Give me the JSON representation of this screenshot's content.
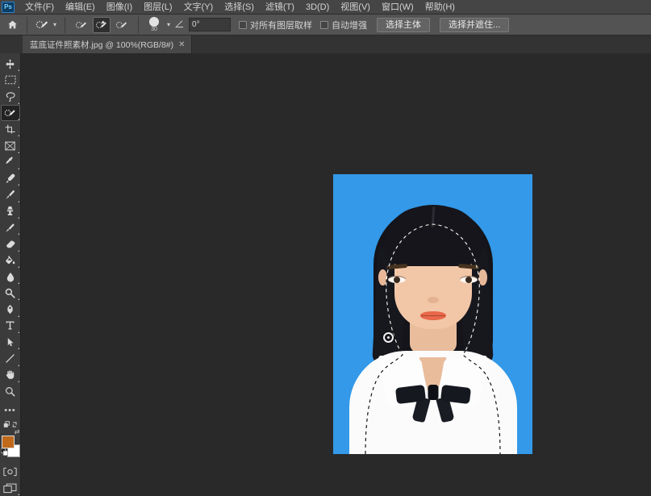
{
  "app": {
    "name": "Adobe Photoshop",
    "logo_text": "Ps",
    "logo_color": "#2d7fd0"
  },
  "menubar": {
    "items": [
      {
        "label": "文件(F)",
        "name": "menu-file"
      },
      {
        "label": "编辑(E)",
        "name": "menu-edit"
      },
      {
        "label": "图像(I)",
        "name": "menu-image"
      },
      {
        "label": "图层(L)",
        "name": "menu-layer"
      },
      {
        "label": "文字(Y)",
        "name": "menu-type"
      },
      {
        "label": "选择(S)",
        "name": "menu-select"
      },
      {
        "label": "滤镜(T)",
        "name": "menu-filter"
      },
      {
        "label": "3D(D)",
        "name": "menu-3d"
      },
      {
        "label": "视图(V)",
        "name": "menu-view"
      },
      {
        "label": "窗口(W)",
        "name": "menu-window"
      },
      {
        "label": "帮助(H)",
        "name": "menu-help"
      }
    ]
  },
  "options_bar": {
    "home_icon": "home-icon",
    "tool_preset_icon": "quick-selection-brush-icon",
    "modes": [
      {
        "name": "new-selection-mode",
        "icon": "brush-new-icon",
        "active": false
      },
      {
        "name": "add-to-selection-mode",
        "icon": "brush-add-icon",
        "active": true
      },
      {
        "name": "subtract-from-selection-mode",
        "icon": "brush-subtract-icon",
        "active": false
      }
    ],
    "brush_size": "30",
    "angle_value": "0°",
    "sample_all_layers": {
      "label": "对所有图层取样",
      "checked": false
    },
    "auto_enhance": {
      "label": "自动增强",
      "checked": false
    },
    "select_subject_label": "选择主体",
    "select_and_mask_label": "选择并遮住..."
  },
  "tabs": [
    {
      "title": "蓝底证件照素材.jpg @ 100%(RGB/8#)",
      "close_icon": "close-icon",
      "active": true
    }
  ],
  "toolbar": {
    "tools": [
      {
        "name": "move-tool",
        "icon": "move-icon",
        "glyph": "✥",
        "active": false
      },
      {
        "name": "rectangular-marquee-tool",
        "icon": "marquee-icon",
        "glyph": "▭",
        "active": false
      },
      {
        "name": "lasso-tool",
        "icon": "lasso-icon",
        "glyph": "lasso",
        "active": false
      },
      {
        "name": "quick-selection-tool",
        "icon": "quick-selection-icon",
        "glyph": "brush",
        "active": true
      },
      {
        "name": "crop-tool",
        "icon": "crop-icon",
        "glyph": "crop",
        "active": false
      },
      {
        "name": "frame-tool",
        "icon": "frame-icon",
        "glyph": "⊠",
        "active": false
      },
      {
        "name": "eyedropper-tool",
        "icon": "eyedropper-icon",
        "glyph": "dropper",
        "active": false
      },
      {
        "name": "spot-healing-brush-tool",
        "icon": "healing-brush-icon",
        "glyph": "heal",
        "active": false
      },
      {
        "name": "brush-tool",
        "icon": "brush-icon",
        "glyph": "brush2",
        "active": false
      },
      {
        "name": "clone-stamp-tool",
        "icon": "clone-stamp-icon",
        "glyph": "stamp",
        "active": false
      },
      {
        "name": "history-brush-tool",
        "icon": "history-brush-icon",
        "glyph": "hbrush",
        "active": false
      },
      {
        "name": "eraser-tool",
        "icon": "eraser-icon",
        "glyph": "eraser",
        "active": false
      },
      {
        "name": "gradient-tool",
        "icon": "paint-bucket-icon",
        "glyph": "bucket",
        "active": false
      },
      {
        "name": "blur-tool",
        "icon": "blur-drop-icon",
        "glyph": "drop",
        "active": false
      },
      {
        "name": "dodge-tool",
        "icon": "dodge-icon",
        "glyph": "dodge",
        "active": false
      },
      {
        "name": "pen-tool",
        "icon": "pen-icon",
        "glyph": "pen",
        "active": false
      },
      {
        "name": "horizontal-type-tool",
        "icon": "type-icon",
        "glyph": "T",
        "active": false
      },
      {
        "name": "path-selection-tool",
        "icon": "path-arrow-icon",
        "glyph": "arrow",
        "active": false
      },
      {
        "name": "line-shape-tool",
        "icon": "line-shape-icon",
        "glyph": "/",
        "active": false
      },
      {
        "name": "hand-tool",
        "icon": "hand-icon",
        "glyph": "hand",
        "active": false
      },
      {
        "name": "zoom-tool",
        "icon": "magnifier-icon",
        "glyph": "zoom",
        "active": false
      }
    ],
    "more_tools_label": "•••",
    "edit_toolbar_icon": "edit-toolbar-icon",
    "foreground_color": "#c1691a",
    "background_color": "#ffffff",
    "swap_colors_icon": "swap-colors-icon",
    "default_colors_icon": "default-colors-icon",
    "quick_mask_icon": "quick-mask-icon",
    "screen_mode_icon": "screen-mode-icon"
  },
  "document": {
    "background_color": "#3399e8",
    "canvas_bg": "#292929",
    "selection_active": true,
    "zoom": "100%",
    "color_mode": "RGB/8#",
    "subject": {
      "hair_color": "#14141a",
      "skin_color": "#f2c7a8",
      "shirt_color": "#fbfbfb",
      "bowtie_color": "#16181f",
      "lip_color": "#e8684a"
    },
    "brush_cursor_icon": "brush-cursor-ring"
  }
}
